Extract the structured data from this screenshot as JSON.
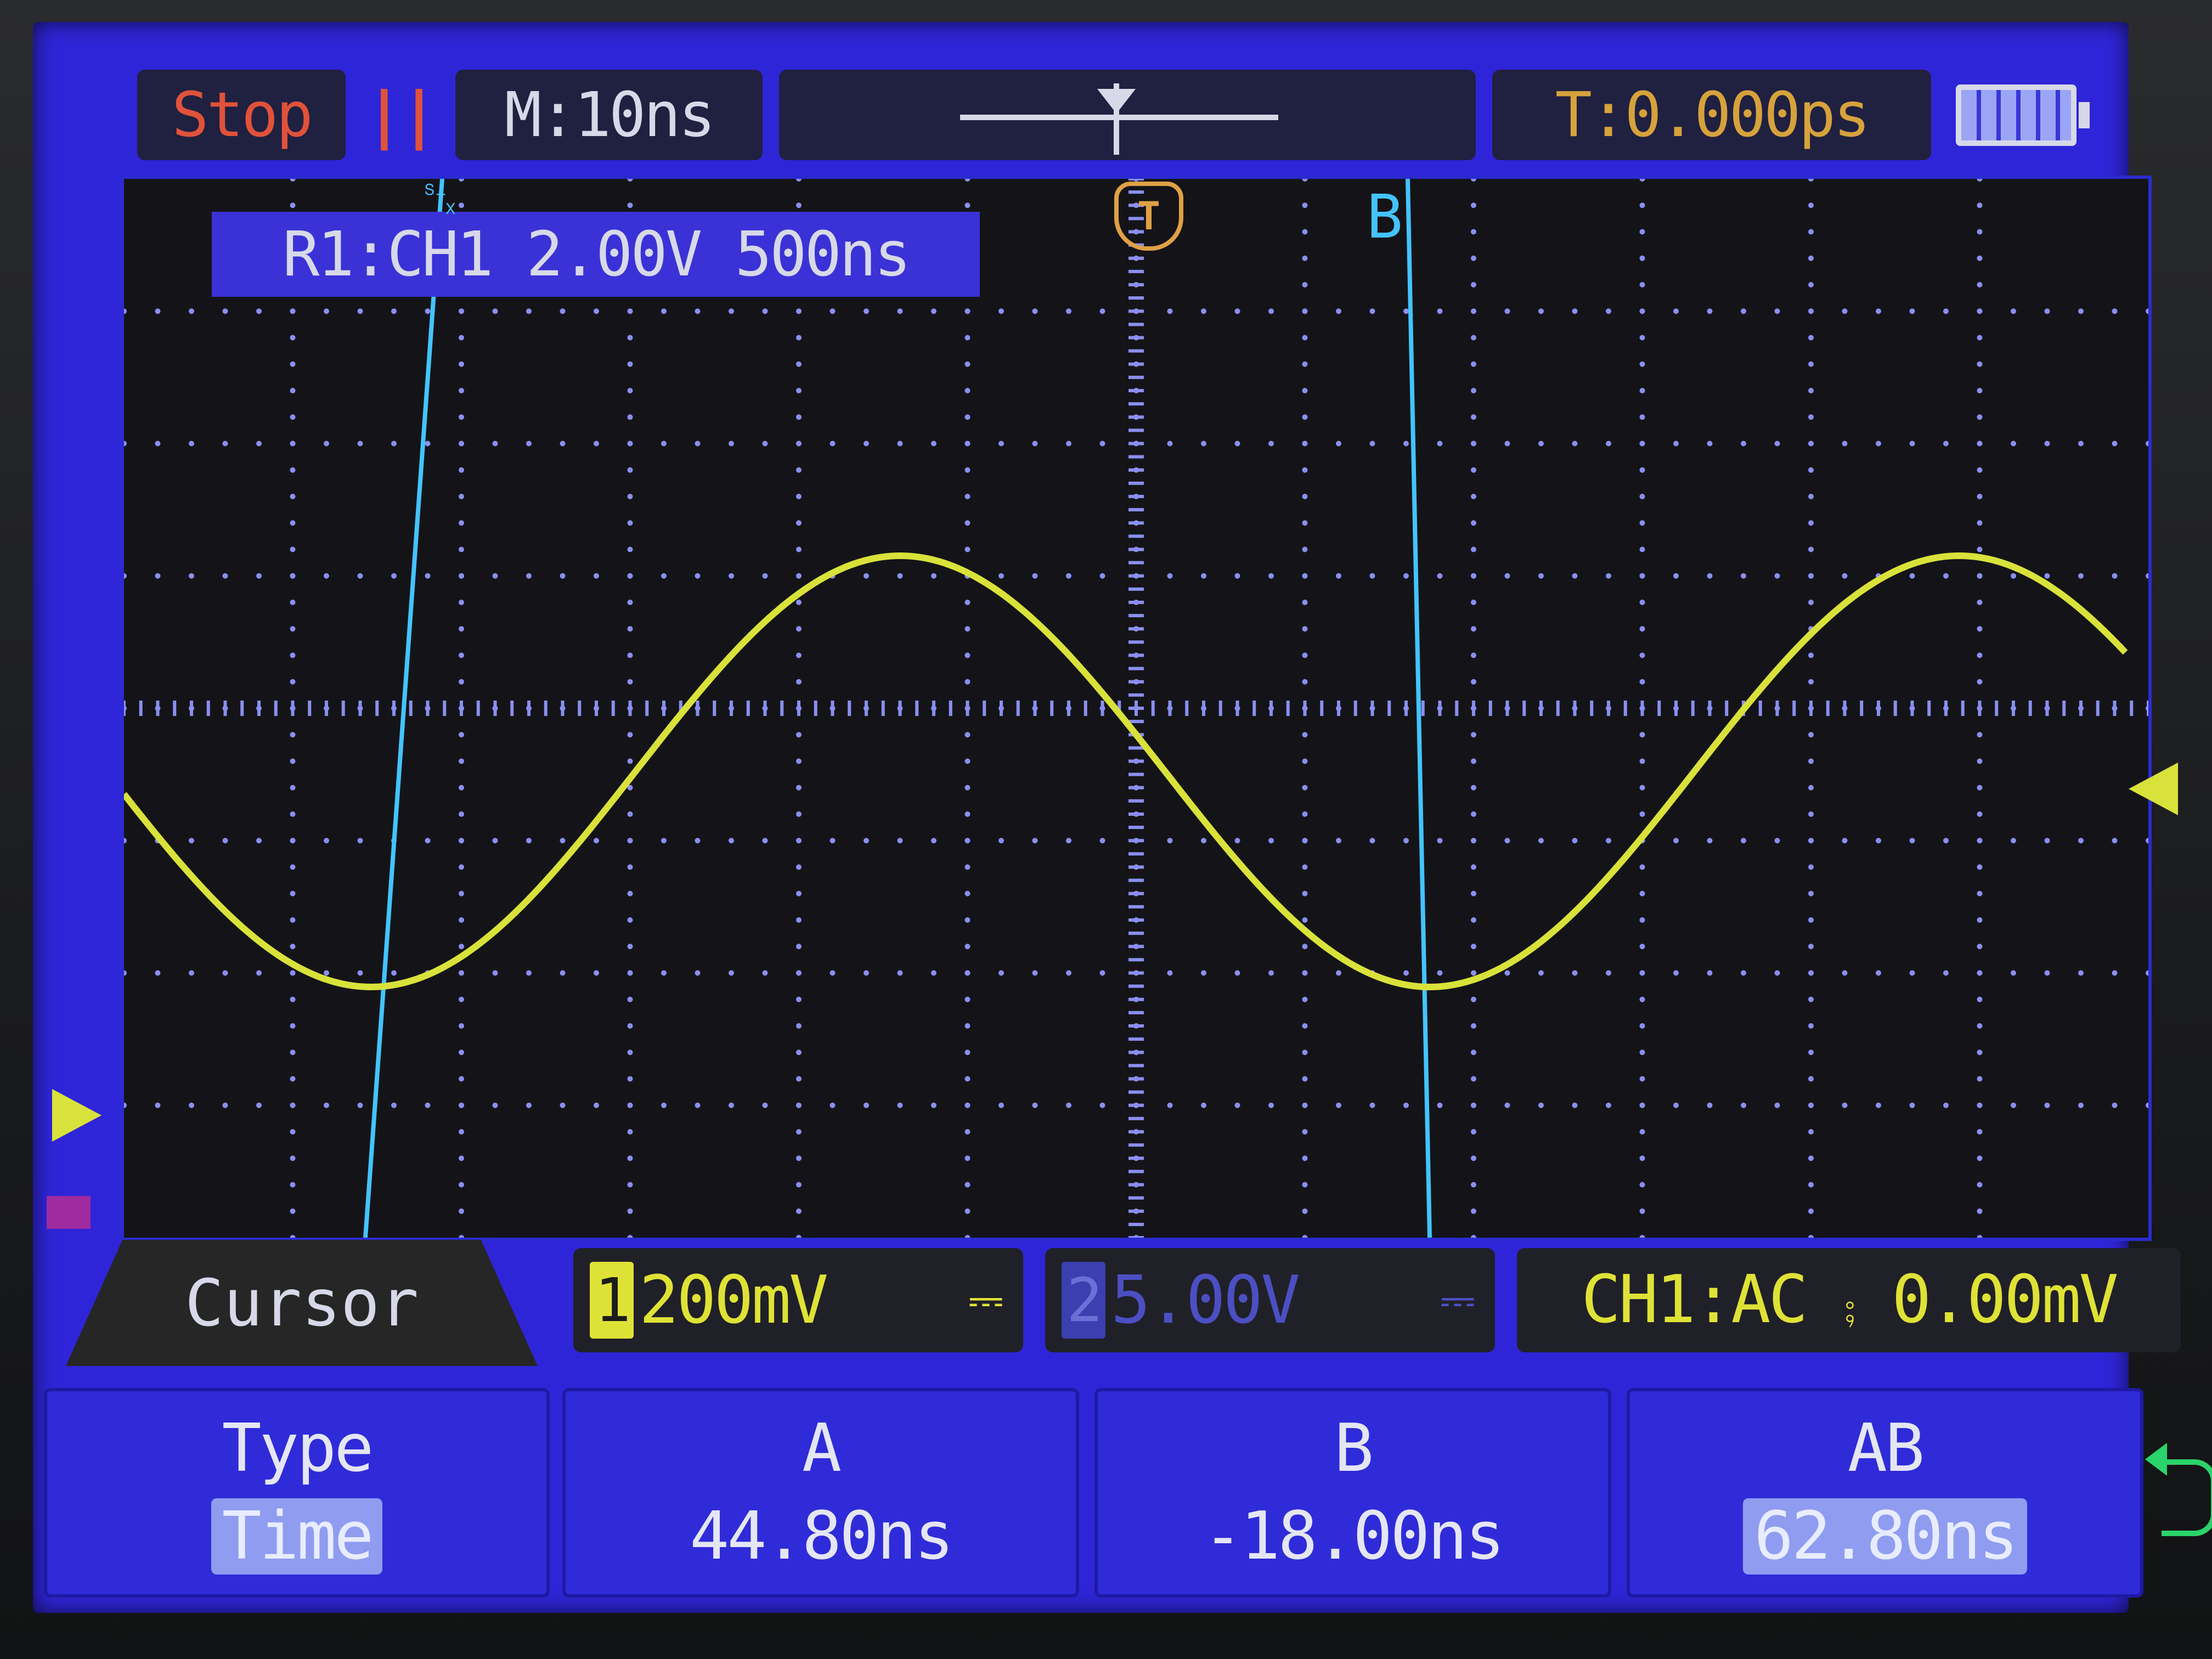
{
  "header": {
    "run_state": "Stop",
    "pause_glyph": "||",
    "timebase": "M:10ns",
    "trigger_time": "T:0.000ps"
  },
  "waveform": {
    "reference_label": "R1:CH1 2.00V 500ns",
    "cursor_a_label": "␂",
    "cursor_b_label": "B",
    "trigger_marker_label": "T",
    "trace_color": "#d9e23a",
    "cursor_color": "#44c3ff",
    "grid_color": "#8a8ff0"
  },
  "channels": {
    "menu_title": "Cursor",
    "ch1": {
      "badge": "1",
      "scale": "200mV",
      "coupling_icon": "⎓"
    },
    "ch2": {
      "badge": "2",
      "scale": "5.00V",
      "coupling_icon": "⎓"
    },
    "trigger_status": "CH1:AC ⨾ 0.00mV"
  },
  "softkeys": {
    "type": {
      "title": "Type",
      "value": "Time"
    },
    "a": {
      "title": "A",
      "value": "44.80ns"
    },
    "b": {
      "title": "B",
      "value": "-18.00ns"
    },
    "ab": {
      "title": "AB",
      "value": "62.80ns"
    }
  }
}
